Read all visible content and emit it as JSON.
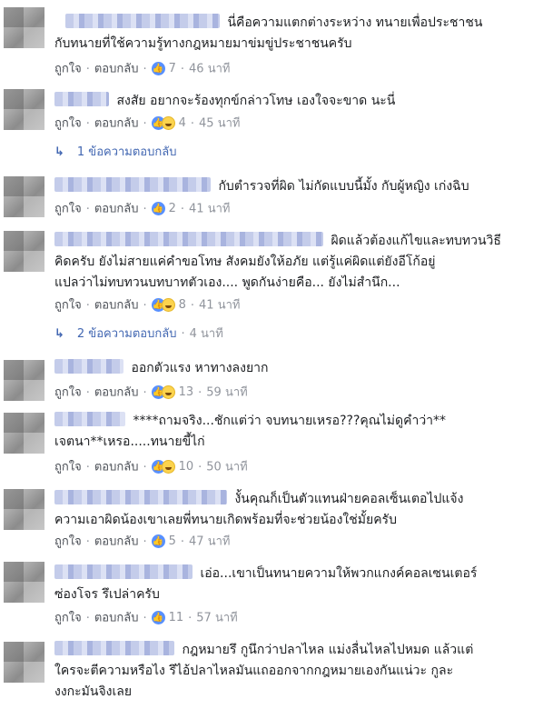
{
  "actions": {
    "like": "ถูกใจ",
    "reply": "ตอบกลับ",
    "sep": "·"
  },
  "comments": [
    {
      "lines": [
        "นี่คือความแตกต่างระหว่าง ทนายเพื่อประชาชน",
        "กับทนายที่ใช้ความรู้ทางกฎหมายมาข่มขู่ประชาชนครับ"
      ],
      "reacts": [
        "like"
      ],
      "count": "7",
      "time": "46 นาที"
    },
    {
      "lines": [
        "สงสัย อยากจะร้องทุกข์กล่าวโทษ เองใจจะขาด นะนี่"
      ],
      "reacts": [
        "like",
        "haha"
      ],
      "count": "4",
      "time": "45 นาที",
      "replies": {
        "text": "1 ข้อความตอบกลับ",
        "time": ""
      }
    },
    {
      "lines": [
        "กับตำรวจที่ผิด ไม่กัดแบบนี้มั้ง กับผู้หญิง เก่งฉิบ"
      ],
      "reacts": [
        "like"
      ],
      "count": "2",
      "time": "41 นาที"
    },
    {
      "lines": [
        "ผิดแล้วต้องแก้ไขและทบทวนวิธี",
        "คิดครับ ยังไม่สายแค่คำขอโทษ สังคมยังให้อภัย แต่รู้แค่ผิดแต่ยังอีโก้อยู่",
        "แปลว่าไม่ทบทวนบทบาทตัวเอง.... พูดกันง่ายคือ... ยังไม่สำนึก..."
      ],
      "reacts": [
        "like",
        "haha"
      ],
      "count": "8",
      "time": "41 นาที",
      "replies": {
        "text": "2 ข้อความตอบกลับ",
        "time": "4 นาที"
      }
    },
    {
      "lines": [
        "ออกตัวแรง หาทางลงยาก"
      ],
      "reacts": [
        "like",
        "haha"
      ],
      "count": "13",
      "time": "59 นาที"
    },
    {
      "lines": [
        "****ถามจริง...ชักแต่ว่า จบทนายเหรอ???คุณไม่ดูคำว่า**",
        "เจตนา**เหรอ.....ทนายขี้ไก่"
      ],
      "reacts": [
        "like",
        "haha"
      ],
      "count": "10",
      "time": "50 นาที"
    },
    {
      "lines": [
        "งั้นคุณก็เป็นตัวแทนฝ่ายคอลเซ็นเตอไปแจ้ง",
        "ความเอาผิดน้องเขาเลยพี่ทนายเกิดพร้อมที่จะช่วยน้องใช่มั้ยครับ"
      ],
      "reacts": [
        "like"
      ],
      "count": "5",
      "time": "47 นาที"
    },
    {
      "lines": [
        "เอ่อ...เขาเป็นทนายความให้พวกแกงค์คอลเซนเตอร์",
        "ซ่องโจร รึเปล่าครับ"
      ],
      "reacts": [
        "like"
      ],
      "count": "11",
      "time": "57 นาที"
    },
    {
      "lines": [
        "กฎหมายรึ กูนึกว่าปลาไหล แม่งลื่นไหลไปหมด แล้วแต่",
        "ใครจะตีความหรือไง รึไอ้ปลาไหลมันแถออกจากกฎหมายเองกันแน่วะ กูละ",
        "งงกะมันจิงเลย"
      ],
      "reacts": [],
      "count": "",
      "time": ""
    }
  ]
}
